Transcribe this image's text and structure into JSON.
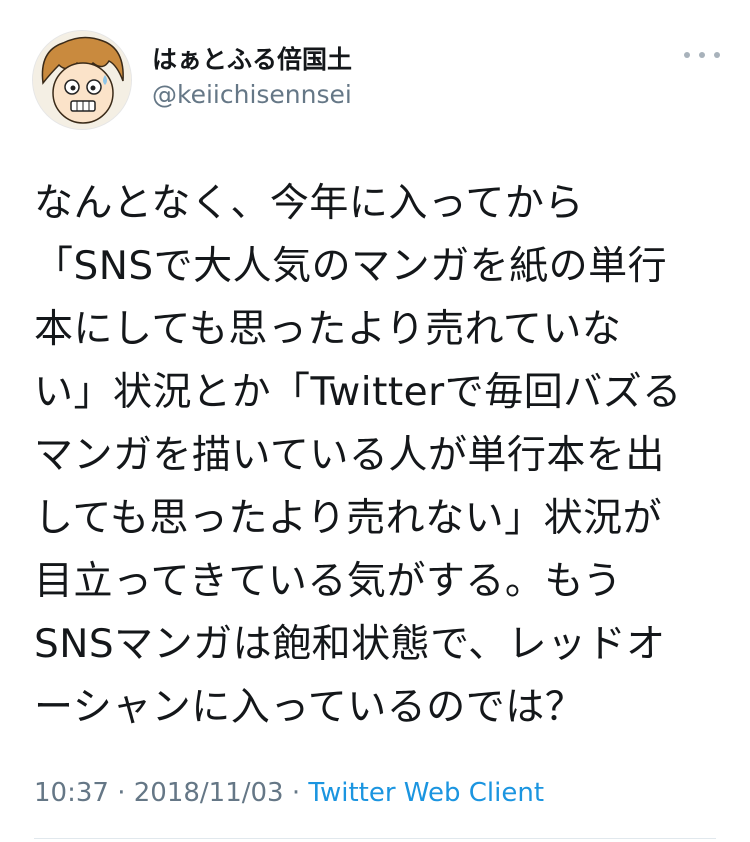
{
  "author": {
    "display_name": "はぁとふる倍国土",
    "handle": "@keiichisennsei"
  },
  "tweet": {
    "lines": [
      "なんとなく、今年に入ってから",
      "「SNSで大人気のマンガを紙の単行",
      "本にしても思ったより売れていな",
      "い」状況とか「Twitterで毎回バズる",
      "マンガを描いている人が単行本を出",
      "しても思ったより売れない」状況が",
      "目立ってきている気がする。もう",
      "SNSマンガは飽和状態で、レッドオ",
      "ーシャンに入っているのでは？"
    ]
  },
  "meta": {
    "time": "10:37",
    "sep1": " · ",
    "date": "2018/11/03",
    "sep2": " · ",
    "client": "Twitter Web Client"
  },
  "icons": {
    "avatar": "avatar-illustration",
    "more": "more-options-icon"
  },
  "colors": {
    "text": "#14171a",
    "secondary": "#657786",
    "link": "#1b95e0"
  }
}
